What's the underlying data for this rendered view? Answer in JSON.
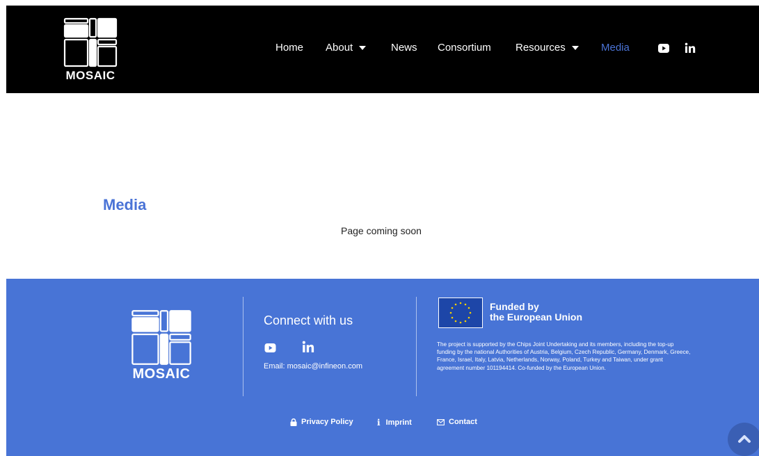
{
  "header": {
    "logo_text": "MOSAIC",
    "nav": [
      {
        "label": "Home",
        "has_dropdown": false,
        "active": false
      },
      {
        "label": "About",
        "has_dropdown": true,
        "active": false
      },
      {
        "label": "News",
        "has_dropdown": false,
        "active": false
      },
      {
        "label": "Consortium",
        "has_dropdown": false,
        "active": false
      },
      {
        "label": "Resources",
        "has_dropdown": true,
        "active": false
      },
      {
        "label": "Media",
        "has_dropdown": false,
        "active": true
      }
    ],
    "social_icons": [
      "youtube-icon",
      "linkedin-icon"
    ]
  },
  "main": {
    "title": "Media",
    "text": "Page coming soon"
  },
  "footer": {
    "logo_text": "MOSAIC",
    "connect_title": "Connect with us",
    "email": "Email: mosaic@infineon.com",
    "eu_line1": "Funded by",
    "eu_line2": "the European Union",
    "eu_description": "The project is supported by the Chips Joint Undertaking and its members, including the top-up funding by the national Authorities of Austria, Belgium, Czech Republic, Germany, Denmark, Greece, France, Israel, Italy, Latvia, Netherlands, Norway, Poland, Turkey and Taiwan, under grant agreement number 101194414. Co-funded by the European Union.",
    "links": [
      {
        "label": "Privacy Policy",
        "icon": "lock-icon"
      },
      {
        "label": "Imprint",
        "icon": "info-icon"
      },
      {
        "label": "Contact",
        "icon": "envelope-icon"
      }
    ]
  },
  "colors": {
    "header_bg": "#000000",
    "accent": "#4a73d6",
    "footer_bg": "#4874d6"
  }
}
